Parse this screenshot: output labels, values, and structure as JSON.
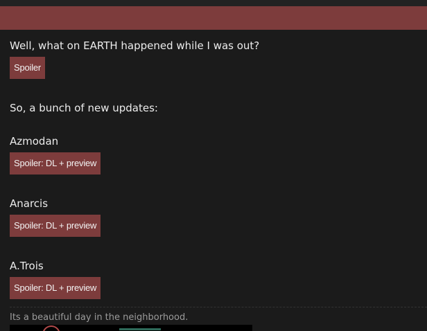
{
  "post": {
    "line1": "Well, what on EARTH happened while I was out?",
    "spoiler1_label": "Spoiler",
    "line2": "So, a bunch of new updates:",
    "entries": [
      {
        "name": "Azmodan",
        "spoiler_label": "Spoiler: DL + preview"
      },
      {
        "name": "Anarcis",
        "spoiler_label": "Spoiler: DL + preview"
      },
      {
        "name": "A.Trois",
        "spoiler_label": "Spoiler: DL + preview"
      }
    ]
  },
  "signature": {
    "text": "Its a beautiful day in the neighborhood."
  },
  "colors": {
    "background": "#1b1b1b",
    "header_bar": "#7d3c3c",
    "spoiler_button": "#7d3c3c",
    "text": "#ececec",
    "signature_text": "#9b9b9b"
  }
}
